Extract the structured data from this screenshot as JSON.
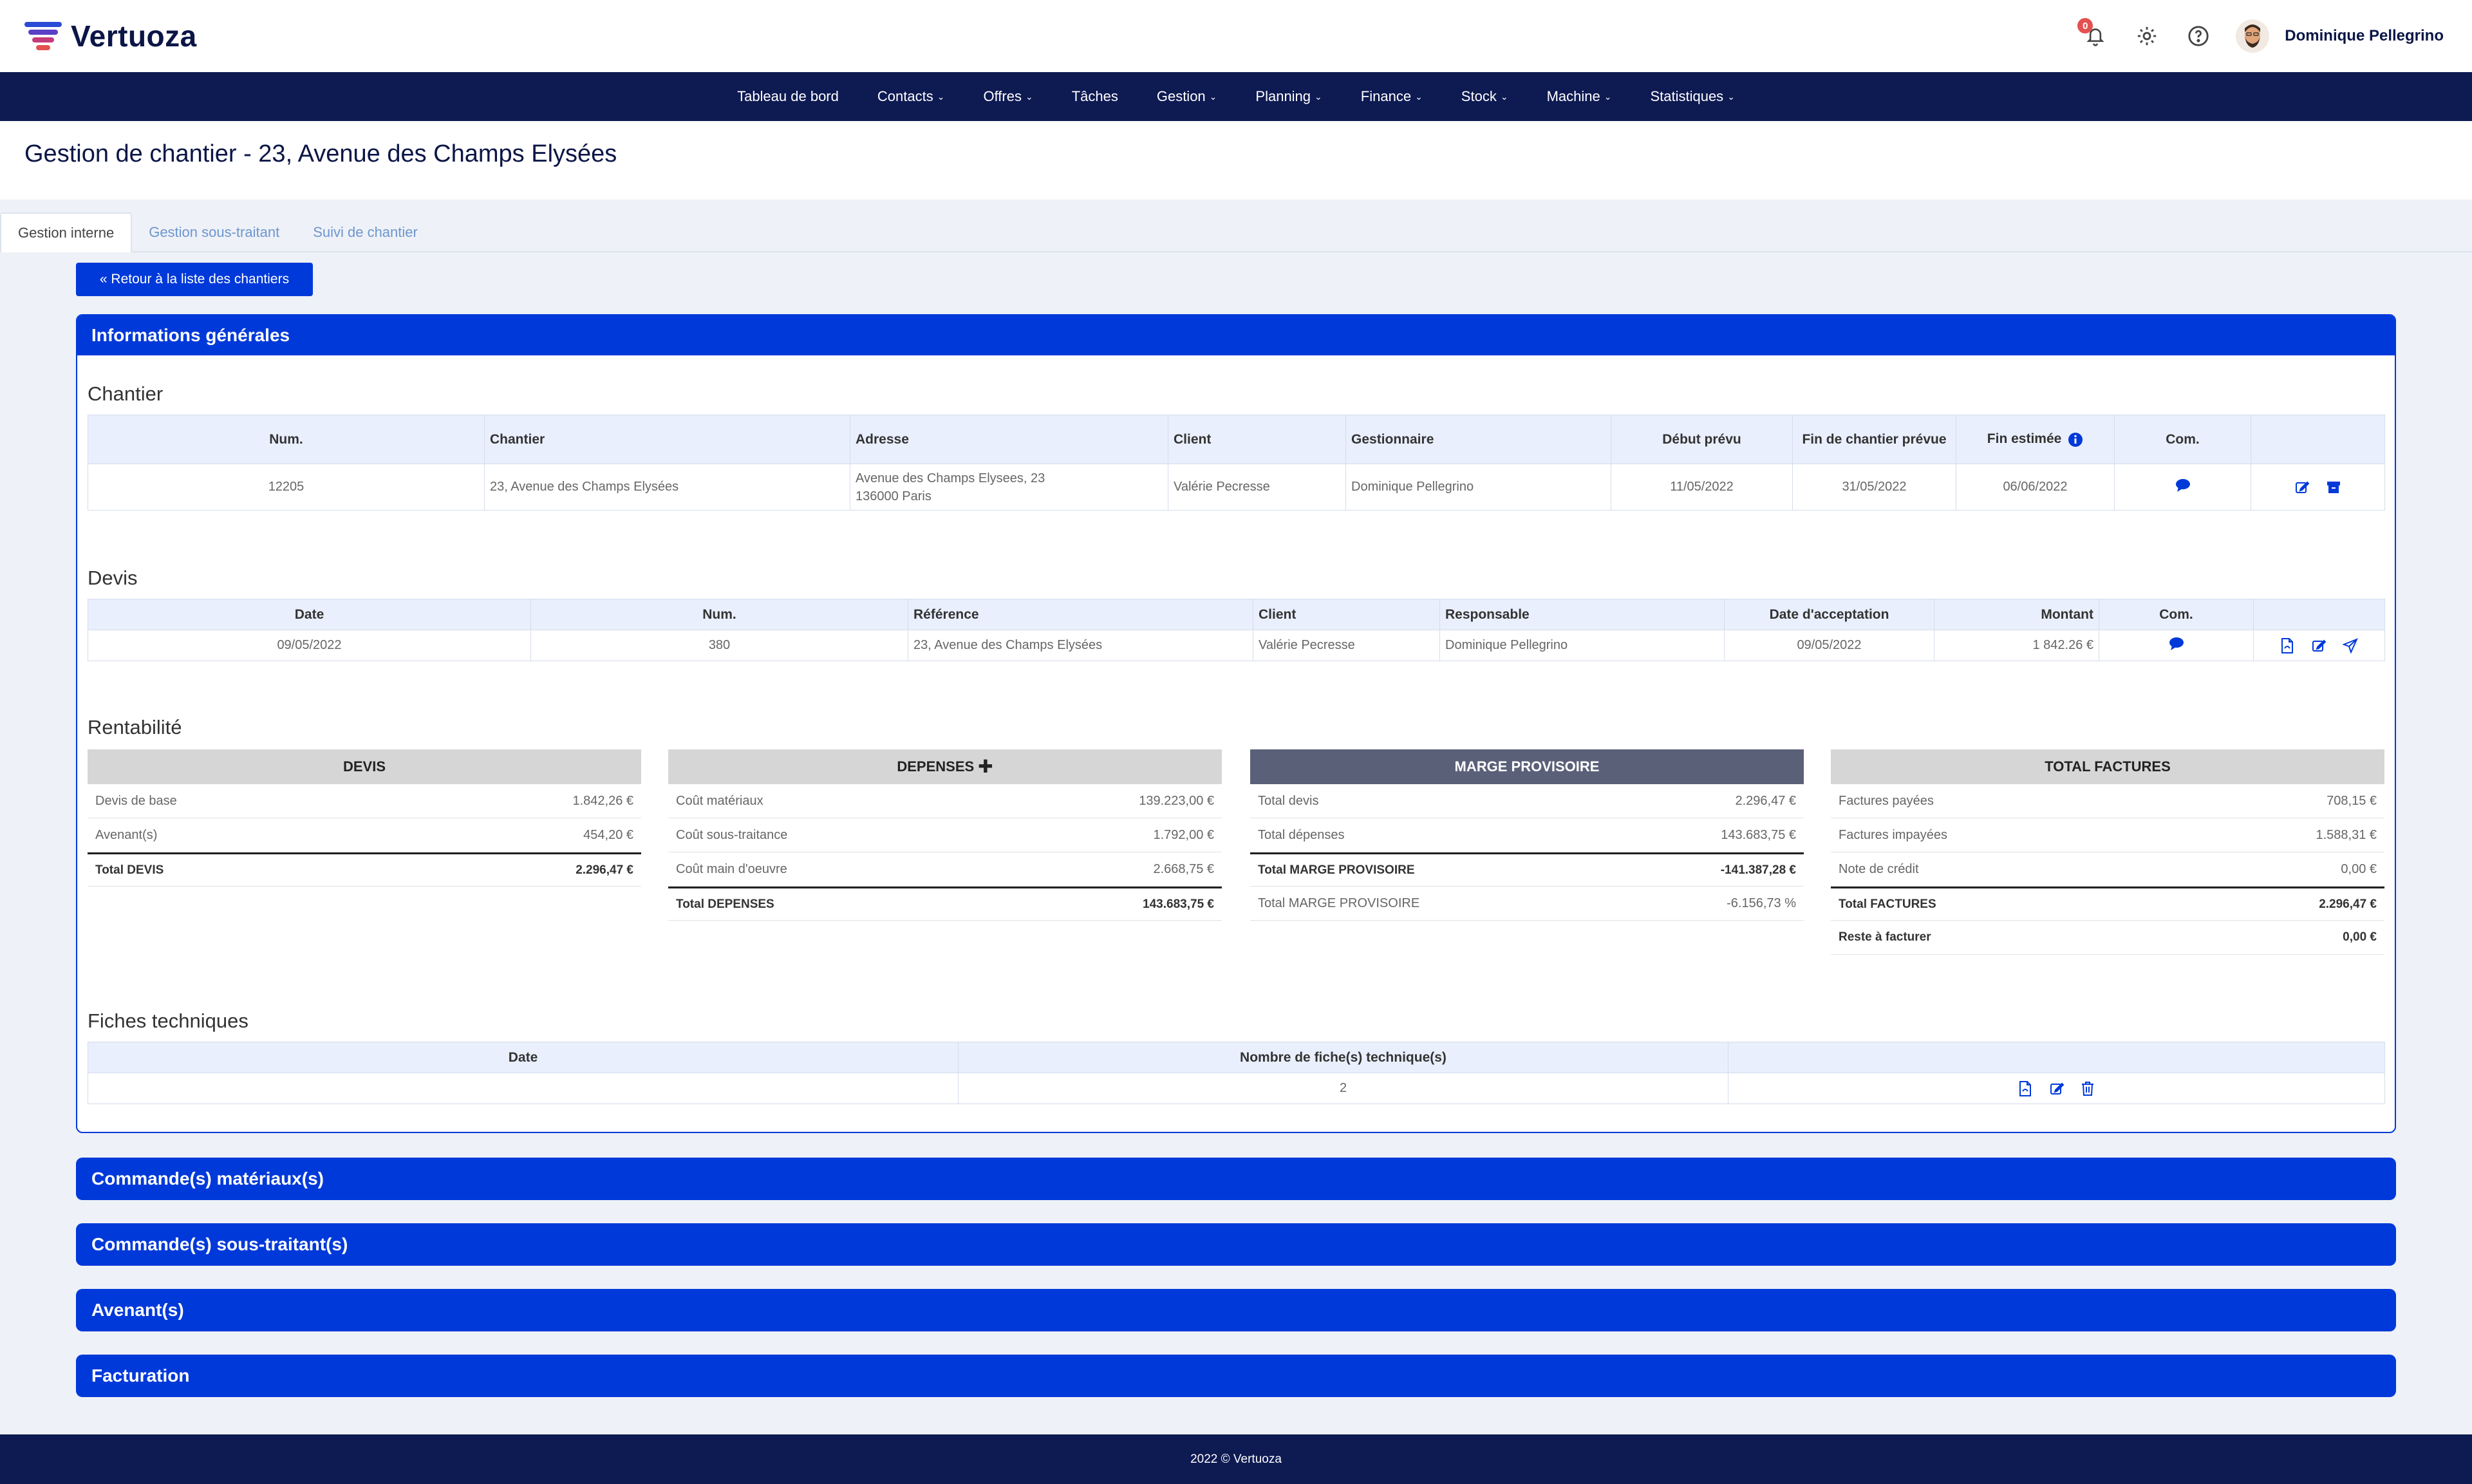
{
  "app": {
    "name": "Vertuoza",
    "notifications_count": "0",
    "user_name": "Dominique Pellegrino",
    "brand_colors": {
      "primary": "#0039d9",
      "navy": "#0e1a52",
      "accent_red": "#e45151"
    },
    "icons": [
      "bell-icon",
      "gear-icon",
      "help-icon"
    ]
  },
  "nav": {
    "items": [
      {
        "label": "Tableau de bord",
        "dropdown": false
      },
      {
        "label": "Contacts",
        "dropdown": true
      },
      {
        "label": "Offres",
        "dropdown": true
      },
      {
        "label": "Tâches",
        "dropdown": false
      },
      {
        "label": "Gestion",
        "dropdown": true
      },
      {
        "label": "Planning",
        "dropdown": true
      },
      {
        "label": "Finance",
        "dropdown": true
      },
      {
        "label": "Stock",
        "dropdown": true
      },
      {
        "label": "Machine",
        "dropdown": true
      },
      {
        "label": "Statistiques",
        "dropdown": true
      }
    ]
  },
  "page": {
    "title": "Gestion de chantier - 23, Avenue des Champs Elysées",
    "tabs": [
      "Gestion interne",
      "Gestion sous-traitant",
      "Suivi de chantier"
    ],
    "active_tab": "Gestion interne",
    "back_button": "« Retour à la liste des chantiers"
  },
  "info": {
    "panel_title": "Informations générales",
    "chantier": {
      "title": "Chantier",
      "headers": [
        "Num.",
        "Chantier",
        "Adresse",
        "Client",
        "Gestionnaire",
        "Début prévu",
        "Fin de chantier prévue",
        "Fin estimée",
        "Com.",
        ""
      ],
      "row": {
        "num": "12205",
        "chantier": "23, Avenue des Champs Elysées",
        "adresse_line1": "Avenue des Champs Elysees, 23",
        "adresse_line2": "136000 Paris",
        "client": "Valérie Pecresse",
        "gestionnaire": "Dominique Pellegrino",
        "debut": "11/05/2022",
        "fin_prevue": "31/05/2022",
        "fin_estimee": "06/06/2022"
      }
    },
    "devis": {
      "title": "Devis",
      "headers": [
        "Date",
        "Num.",
        "Référence",
        "Client",
        "Responsable",
        "Date d'acceptation",
        "Montant",
        "Com.",
        ""
      ],
      "row": {
        "date": "09/05/2022",
        "num": "380",
        "reference": "23, Avenue des Champs Elysées",
        "client": "Valérie Pecresse",
        "responsable": "Dominique Pellegrino",
        "date_acceptation": "09/05/2022",
        "montant": "1 842.26 €"
      }
    },
    "rentabilite": {
      "title": "Rentabilité",
      "devis": {
        "header": "DEVIS",
        "rows": [
          {
            "label": "Devis de base",
            "value": "1.842,26 €"
          },
          {
            "label": "Avenant(s)",
            "value": "454,20 €"
          }
        ],
        "total": {
          "label": "Total DEVIS",
          "value": "2.296,47 €"
        }
      },
      "depenses": {
        "header": "DEPENSES",
        "rows": [
          {
            "label": "Coût matériaux",
            "value": "139.223,00 €"
          },
          {
            "label": "Coût sous-traitance",
            "value": "1.792,00 €"
          },
          {
            "label": "Coût main d'oeuvre",
            "value": "2.668,75 €"
          }
        ],
        "total": {
          "label": "Total DEPENSES",
          "value": "143.683,75 €"
        }
      },
      "marge": {
        "header": "MARGE PROVISOIRE",
        "rows": [
          {
            "label": "Total devis",
            "value": "2.296,47 €"
          },
          {
            "label": "Total dépenses",
            "value": "143.683,75 €"
          }
        ],
        "total": {
          "label": "Total MARGE PROVISOIRE",
          "value": "-141.387,28 €"
        },
        "after": {
          "label": "Total MARGE PROVISOIRE",
          "value": "-6.156,73 %"
        }
      },
      "factures": {
        "header": "TOTAL FACTURES",
        "rows": [
          {
            "label": "Factures payées",
            "value": "708,15 €"
          },
          {
            "label": "Factures impayées",
            "value": "1.588,31 €"
          },
          {
            "label": "Note de crédit",
            "value": "0,00 €"
          }
        ],
        "total": {
          "label": "Total FACTURES",
          "value": "2.296,47 €"
        },
        "after": {
          "label": "Reste à facturer",
          "value": "0,00 €"
        }
      }
    },
    "fiches": {
      "title": "Fiches techniques",
      "headers": [
        "Date",
        "Nombre de fiche(s) technique(s)",
        ""
      ],
      "row": {
        "date": "",
        "nombre": "2"
      }
    }
  },
  "sections": [
    "Commande(s) matériaux(s)",
    "Commande(s) sous-traitant(s)",
    "Avenant(s)",
    "Facturation"
  ],
  "footer": "2022 © Vertuoza"
}
